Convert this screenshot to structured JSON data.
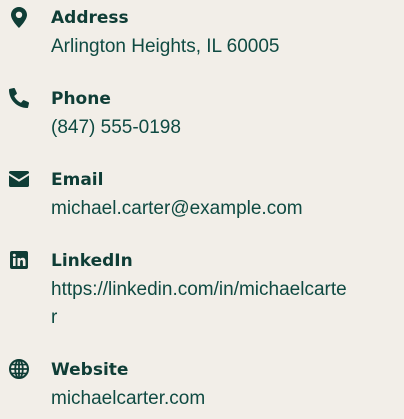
{
  "contact": {
    "items": [
      {
        "icon": "map-pin-icon",
        "label": "Address",
        "value": "Arlington Heights, IL 60005"
      },
      {
        "icon": "phone-icon",
        "label": "Phone",
        "value": "(847) 555-0198"
      },
      {
        "icon": "envelope-icon",
        "label": "Email",
        "value": "michael.carter@example.com"
      },
      {
        "icon": "linkedin-icon",
        "label": "LinkedIn",
        "value": "https://linkedin.com/in/michaelcarter"
      },
      {
        "icon": "globe-icon",
        "label": "Website",
        "value": "michaelcarter.com"
      }
    ]
  },
  "colors": {
    "background": "#f2eee8",
    "text": "#0f3d36"
  }
}
